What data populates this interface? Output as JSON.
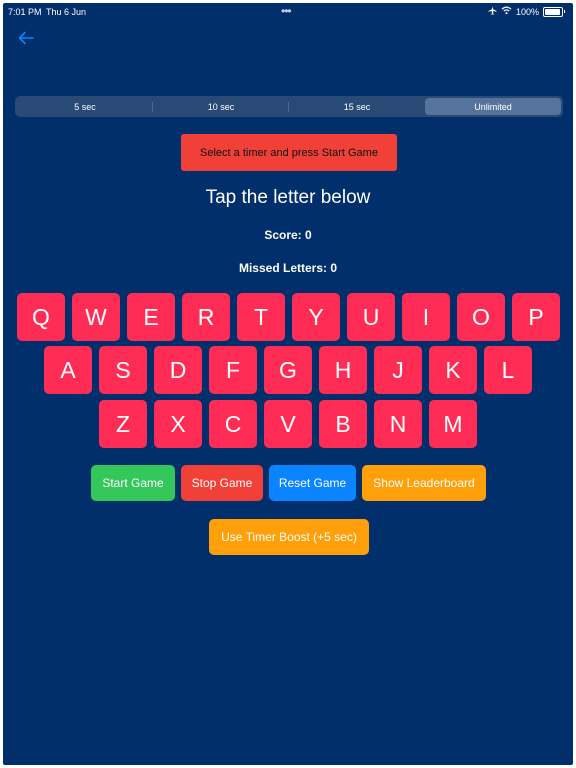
{
  "status_bar": {
    "time": "7:01 PM",
    "date": "Thu 6 Jun",
    "battery_percent": "100%",
    "icons": [
      "airplane-icon",
      "wifi-icon",
      "battery-icon"
    ]
  },
  "navigation": {
    "back_icon": "left-arrow-icon"
  },
  "timer_options": {
    "options": [
      "5 sec",
      "10 sec",
      "15 sec",
      "Unlimited"
    ],
    "selected": "Unlimited"
  },
  "banner": {
    "text": "Select a timer and press Start Game"
  },
  "game": {
    "prompt": "Tap the letter below",
    "score_label": "Score: 0",
    "missed_label": "Missed Letters: 0"
  },
  "keyboard": {
    "row1": [
      "Q",
      "W",
      "E",
      "R",
      "T",
      "Y",
      "U",
      "I",
      "O",
      "P"
    ],
    "row2": [
      "A",
      "S",
      "D",
      "F",
      "G",
      "H",
      "J",
      "K",
      "L"
    ],
    "row3": [
      "Z",
      "X",
      "C",
      "V",
      "B",
      "N",
      "M"
    ]
  },
  "actions": {
    "start": "Start Game",
    "stop": "Stop Game",
    "reset": "Reset Game",
    "leaderboard": "Show Leaderboard",
    "boost": "Use Timer Boost (+5 sec)"
  },
  "colors": {
    "background": "#002f6c",
    "key": "#ff2d55",
    "start": "#34c759",
    "stop": "#f04038",
    "reset": "#0a84ff",
    "leaderboard": "#ff9f0a",
    "boost": "#ff9f0a",
    "accent": "#0a84ff"
  }
}
